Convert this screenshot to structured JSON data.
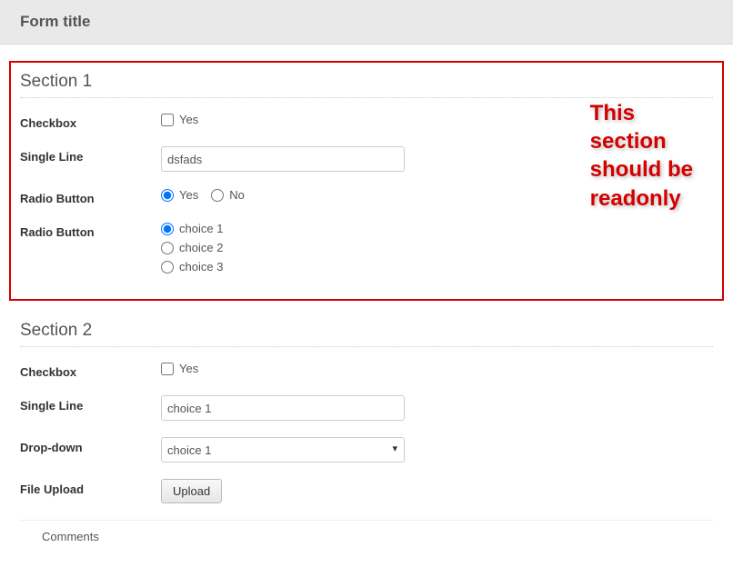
{
  "header": {
    "title": "Form title"
  },
  "annotation": {
    "line1": "This",
    "line2": "section",
    "line3": "should be",
    "line4": "readonly"
  },
  "section1": {
    "title": "Section 1",
    "checkbox": {
      "label": "Checkbox",
      "option": "Yes"
    },
    "singleLine": {
      "label": "Single Line",
      "value": "dsfads"
    },
    "radio1": {
      "label": "Radio Button",
      "opt1": "Yes",
      "opt2": "No"
    },
    "radio2": {
      "label": "Radio Button",
      "opt1": "choice 1",
      "opt2": "choice 2",
      "opt3": "choice 3"
    }
  },
  "section2": {
    "title": "Section 2",
    "checkbox": {
      "label": "Checkbox",
      "option": "Yes"
    },
    "singleLine": {
      "label": "Single Line",
      "value": "choice 1"
    },
    "dropdown": {
      "label": "Drop-down",
      "selected": "choice 1"
    },
    "fileUpload": {
      "label": "File Upload",
      "button": "Upload"
    }
  },
  "comments": {
    "label": "Comments"
  }
}
